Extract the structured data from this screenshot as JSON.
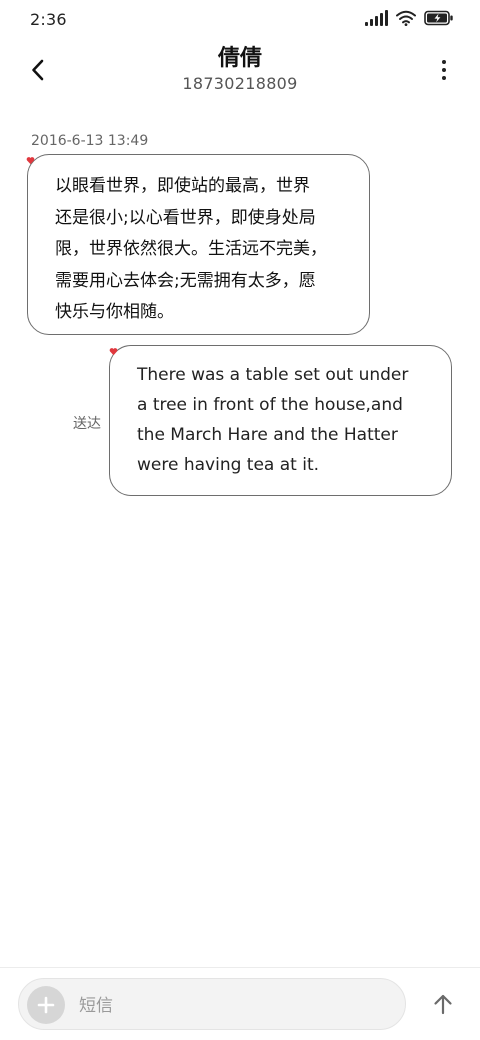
{
  "status_bar": {
    "time": "2:36",
    "icons": [
      "signal-icon",
      "wifi-icon",
      "battery-charging-icon"
    ]
  },
  "header": {
    "contact_name": "倩倩",
    "contact_number": "18730218809",
    "back_icon": "chevron-left-icon",
    "more_icon": "more-vertical-icon"
  },
  "conversation": {
    "timestamp": "2016-6-13 13:49",
    "messages": [
      {
        "direction": "incoming",
        "text": "以眼看世界，即使站的最高，世界还是很小;以心看世界，即使身处局限，世界依然很大。生活远不完美，需要用心去体会;无需拥有太多，愿快乐与你相随。",
        "lines": [
          "以眼看世界，即使站的最高，世界",
          "还是很小;以心看世界，即使身处局",
          "限，世界依然很大。生活远不完美，",
          "需要用心去体会;无需拥有太多，愿",
          "快乐与你相随。"
        ]
      },
      {
        "direction": "outgoing",
        "status": "送达",
        "lines": [
          "There was a table set out under",
          "a tree in front of the house,and",
          "the March Hare and the Hatter",
          "were having tea at it."
        ]
      }
    ]
  },
  "composer": {
    "placeholder": "短信",
    "value": "",
    "add_icon": "plus-icon",
    "send_icon": "arrow-up-icon"
  },
  "colors": {
    "bubble_border": "#6e6e6e",
    "heart": "#e0383e",
    "composer_bg": "#f3f3f3"
  }
}
